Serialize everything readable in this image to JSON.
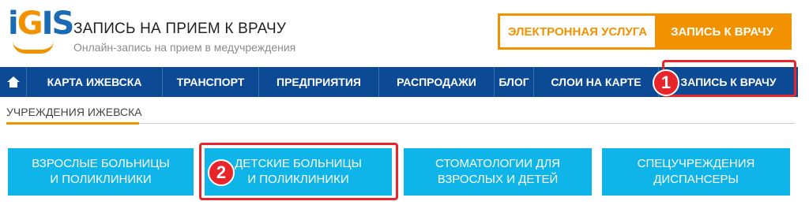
{
  "logo": {
    "text_i": "i",
    "text_g": "G",
    "text_is": "IS"
  },
  "header": {
    "title": "ЗАПИСЬ НА ПРИЕМ К ВРАЧУ",
    "subtitle": "Онлайн-запись на прием в медучреждения"
  },
  "service": {
    "left_label": "ЭЛЕКТРОННАЯ УСЛУГА",
    "right_label": "ЗАПИСЬ К ВРАЧУ",
    "accent": "#f39200"
  },
  "nav": {
    "items": [
      {
        "label": "КАРТА ИЖЕВСКА"
      },
      {
        "label": "ТРАНСПОРТ"
      },
      {
        "label": "ПРЕДПРИЯТИЯ"
      },
      {
        "label": "РАСПРОДАЖИ"
      },
      {
        "label": "БЛОГ"
      },
      {
        "label": "СЛОИ НА КАРТЕ"
      },
      {
        "label": "ЗАПИСЬ К ВРАЧУ"
      }
    ],
    "home_icon": "home-icon",
    "background": "#0d4a95"
  },
  "section": {
    "title": "УЧРЕЖДЕНИЯ ИЖЕВСКА"
  },
  "categories": [
    {
      "line1": "ВЗРОСЛЫЕ БОЛЬНИЦЫ",
      "line2": "И ПОЛИКЛИНИКИ"
    },
    {
      "line1": "ДЕТСКИЕ БОЛЬНИЦЫ",
      "line2": "И ПОЛИКЛИНИКИ"
    },
    {
      "line1": "СТОМАТОЛОГИИ ДЛЯ",
      "line2": "ВЗРОСЛЫХ И ДЕТЕЙ"
    },
    {
      "line1": "СПЕЦУЧРЕЖДЕНИЯ",
      "line2": "ДИСПАНСЕРЫ"
    }
  ],
  "annotations": {
    "badge1": "1",
    "badge2": "2",
    "color": "#e8252a"
  }
}
